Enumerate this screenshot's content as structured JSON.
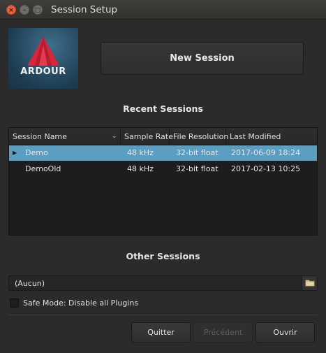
{
  "window": {
    "title": "Session Setup",
    "close_glyph": "×",
    "minimize_glyph": "–",
    "maximize_glyph": "□"
  },
  "logo": {
    "text": "ARDOUR"
  },
  "new_session": {
    "label": "New Session"
  },
  "recent": {
    "title": "Recent Sessions",
    "columns": [
      "Session Name",
      "Sample Rate",
      "File Resolution",
      "Last Modified"
    ],
    "rows": [
      {
        "name": "Demo",
        "sample_rate": "48 kHz",
        "resolution": "32-bit float",
        "modified": "2017-06-09 18:24",
        "selected": true
      },
      {
        "name": "DemoOld",
        "sample_rate": "48 kHz",
        "resolution": "32-bit float",
        "modified": "2017-02-13 10:25",
        "selected": false
      }
    ],
    "sort_icon": "⌄",
    "expander_icon": "▶"
  },
  "other": {
    "title": "Other Sessions",
    "combo_value": "(Aucun)"
  },
  "safe_mode": {
    "label": "Safe Mode: Disable all Plugins",
    "checked": false
  },
  "buttons": {
    "quit": "Quitter",
    "previous": "Précédent",
    "open": "Ouvrir"
  },
  "colors": {
    "selection": "#5b9ec2",
    "logo_red": "#d8253a",
    "close_button": "#e8603c"
  }
}
